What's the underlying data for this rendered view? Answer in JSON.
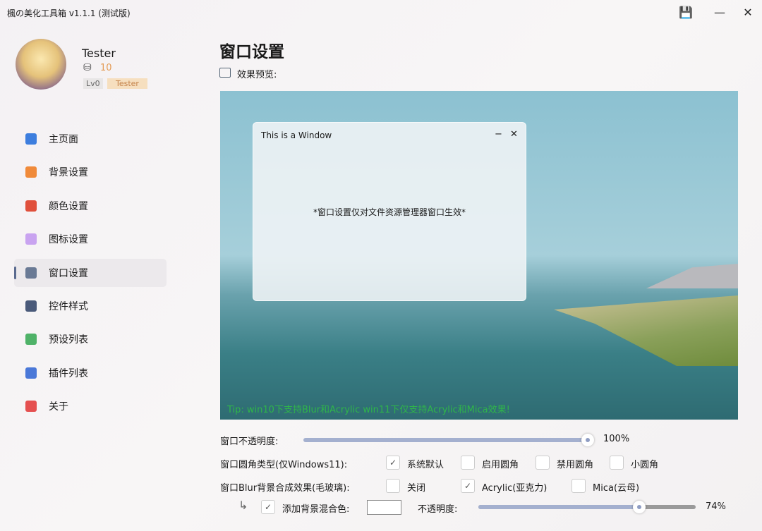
{
  "window": {
    "title": "楓の美化工具箱 v1.1.1 (测试版)",
    "save": "💾",
    "minimize": "—",
    "close": "✕"
  },
  "user": {
    "name": "Tester",
    "coins": "10",
    "level": "Lv0",
    "tag": "Tester"
  },
  "nav": [
    {
      "label": "主页面",
      "color": "#3d7ede"
    },
    {
      "label": "背景设置",
      "color": "#f08a3a"
    },
    {
      "label": "颜色设置",
      "color": "#e0503c"
    },
    {
      "label": "图标设置",
      "color": "#c9a3f0"
    },
    {
      "label": "窗口设置",
      "color": "#6a7a95"
    },
    {
      "label": "控件样式",
      "color": "#4a5a7a"
    },
    {
      "label": "预设列表",
      "color": "#4fb268"
    },
    {
      "label": "插件列表",
      "color": "#4a78d8"
    },
    {
      "label": "关于",
      "color": "#e55050"
    }
  ],
  "page": {
    "title": "窗口设置",
    "preview_label": "效果预览:"
  },
  "preview": {
    "window_title": "This is a Window",
    "min": "−",
    "close": "✕",
    "message": "*窗口设置仅对文件资源管理器窗口生效*",
    "tip": "Tip: win10下支持Blur和Acrylic win11下仅支持Acrylic和Mica效果!"
  },
  "settings": {
    "opacity": {
      "label": "窗口不透明度:",
      "value": 100,
      "display": "100%"
    },
    "corner": {
      "label": "窗口圆角类型(仅Windows11):",
      "options": [
        {
          "label": "系统默认",
          "checked": true
        },
        {
          "label": "启用圆角",
          "checked": false
        },
        {
          "label": "禁用圆角",
          "checked": false
        },
        {
          "label": "小圆角",
          "checked": false
        }
      ]
    },
    "blur": {
      "label": "窗口Blur背景合成效果(毛玻璃):",
      "options": [
        {
          "label": "关闭",
          "checked": false
        },
        {
          "label": "Acrylic(亚克力)",
          "checked": true
        },
        {
          "label": "Mica(云母)",
          "checked": false
        }
      ]
    },
    "blend": {
      "arrow": "↳",
      "label": "添加背景混合色:",
      "checked": true,
      "opacity_label": "不透明度:",
      "value": 74,
      "display": "74%"
    }
  }
}
